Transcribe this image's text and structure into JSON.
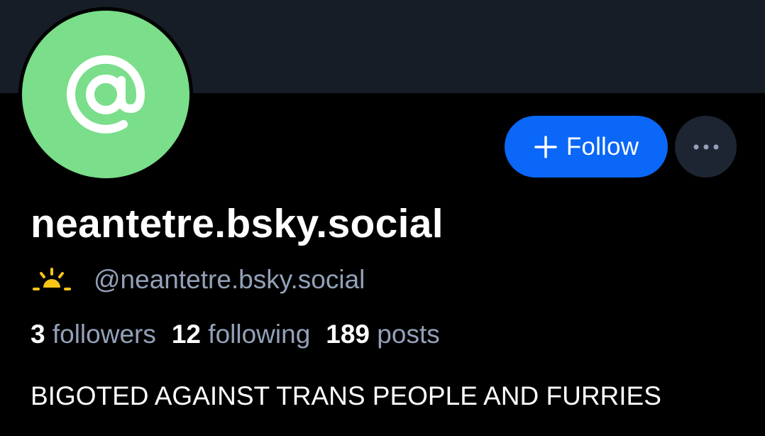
{
  "profile": {
    "display_name": "neantetre.bsky.social",
    "handle": "@neantetre.bsky.social",
    "bio": "BIGOTED AGAINST TRANS PEOPLE AND FURRIES",
    "avatar_color": "#7ade8a",
    "avatar_icon": "at-sign-icon",
    "handle_icon": "sunrise-icon"
  },
  "actions": {
    "follow_label": "Follow",
    "follow_icon": "plus-icon",
    "more_icon": "ellipsis-icon",
    "accent_color": "#0a67f8"
  },
  "stats": {
    "followers_count": "3",
    "followers_label": "followers",
    "following_count": "12",
    "following_label": "following",
    "posts_count": "189",
    "posts_label": "posts"
  }
}
